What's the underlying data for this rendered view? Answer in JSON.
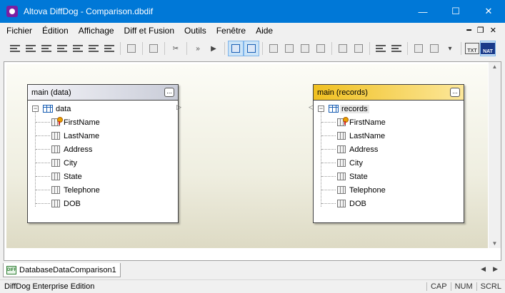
{
  "window": {
    "title": "Altova DiffDog - Comparison.dbdif",
    "minimize": "—",
    "maximize": "☐",
    "close": "✕"
  },
  "menu": {
    "items": [
      "Fichier",
      "Édition",
      "Affichage",
      "Diff et Fusion",
      "Outils",
      "Fenêtre",
      "Aide"
    ],
    "mdi_minimize": "━",
    "mdi_restore": "❐",
    "mdi_close": "✕"
  },
  "toolbar": {
    "nat_label": "NAT",
    "txt_label": "TXT"
  },
  "left_table": {
    "header": "main (data)",
    "more": "...",
    "table_name": "data",
    "columns": [
      "FirstName",
      "LastName",
      "Address",
      "City",
      "State",
      "Telephone",
      "DOB"
    ]
  },
  "right_table": {
    "header": "main (records)",
    "more": "...",
    "table_name": "records",
    "columns": [
      "FirstName",
      "LastName",
      "Address",
      "City",
      "State",
      "Telephone",
      "DOB"
    ]
  },
  "doc_tab": {
    "label": "DatabaseDataComparison1",
    "icon_text": "DIFF"
  },
  "status": {
    "text": "DiffDog Enterprise Edition",
    "cap": "CAP",
    "num": "NUM",
    "scrl": "SCRL"
  }
}
